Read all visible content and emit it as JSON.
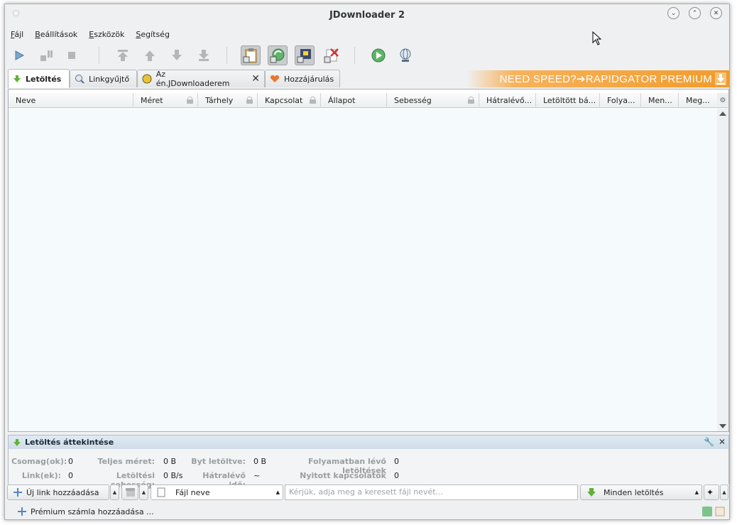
{
  "window": {
    "title": "JDownloader 2"
  },
  "menu": [
    {
      "label": "Fájl",
      "mn": "F"
    },
    {
      "label": "Beállítások",
      "mn": "B"
    },
    {
      "label": "Eszközök",
      "mn": "E"
    },
    {
      "label": "Segítség",
      "mn": "S"
    }
  ],
  "toolbar": {
    "icons": [
      "play-icon",
      "pause-icon",
      "stop-icon",
      "move-top-icon",
      "move-up-icon",
      "move-down-icon",
      "move-bottom-icon",
      "clipboard-observer-icon",
      "auto-reconnect-icon",
      "silent-mode-icon",
      "clear-icon",
      "update-icon",
      "reconnect-icon"
    ]
  },
  "tabs": [
    {
      "label": "Letöltés",
      "active": true
    },
    {
      "label": "Linkgyűjtő",
      "active": false
    },
    {
      "label": "Az én.JDownloaderem",
      "active": false,
      "closable": true
    },
    {
      "label": "Hozzájárulás",
      "active": false
    }
  ],
  "promo": {
    "text": "NEED SPEED?➔RAPIDGATOR PREMIUM"
  },
  "columns": [
    {
      "label": "Neve"
    },
    {
      "label": "Méret"
    },
    {
      "label": "Tárhely"
    },
    {
      "label": "Kapcsolat"
    },
    {
      "label": "Állapot"
    },
    {
      "label": "Sebesség"
    },
    {
      "label": "Hátralévő..."
    },
    {
      "label": "Letöltött bá..."
    },
    {
      "label": "Folya..."
    },
    {
      "label": "Men..."
    },
    {
      "label": "Meg..."
    }
  ],
  "overview": {
    "title": "Letöltés áttekintése",
    "fields": {
      "packages_label": "Csomag(ok):",
      "packages_value": "0",
      "links_label": "Link(ek):",
      "links_value": "0",
      "total_size_label": "Teljes méret:",
      "total_size_value": "0 B",
      "speed_label": "Letöltési sebesség:",
      "speed_value": "0 B/s",
      "bytes_label": "Byt letöltve:",
      "bytes_value": "0 B",
      "eta_label": "Hátralévő idő:",
      "eta_value": "~",
      "running_label": "Folyamatban lévő letöltések",
      "running_value": "0",
      "connections_label": "Nyitott kapcsolatok",
      "connections_value": "0"
    }
  },
  "bottom": {
    "add_links": "Új link hozzáadása",
    "search_mode": "Fájl neve",
    "search_placeholder": "Kérjük, adja meg a keresett fájl nevét...",
    "all_downloads": "Minden letöltés"
  },
  "status": {
    "premium_add": "Prémium számla hozzáadása ..."
  }
}
